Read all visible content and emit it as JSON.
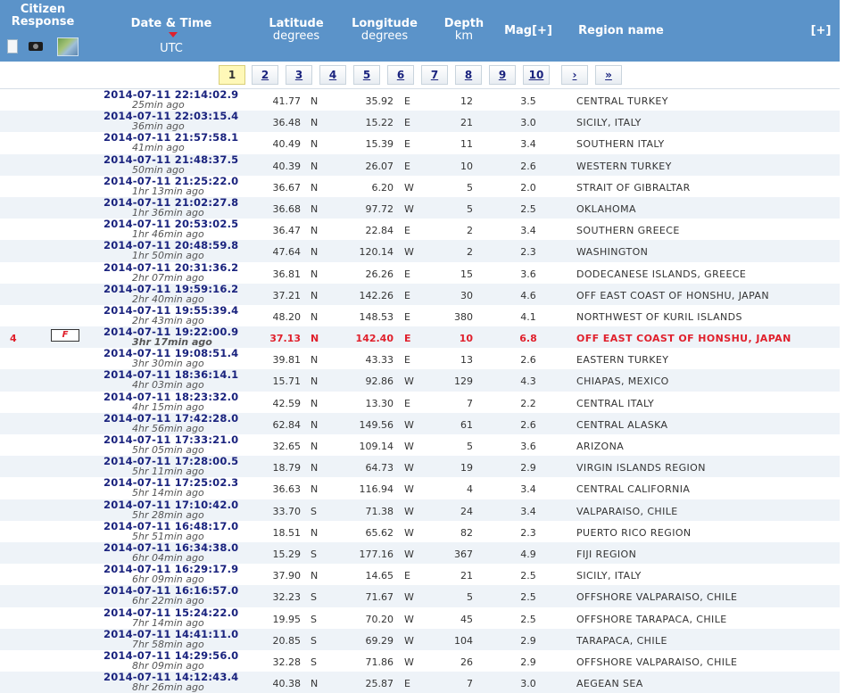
{
  "header": {
    "citizen_response": "Citizen Response",
    "date_time": "Date & Time",
    "date_time_sub": "UTC",
    "latitude": "Latitude",
    "latitude_sub": "degrees",
    "longitude": "Longitude",
    "longitude_sub": "degrees",
    "depth": "Depth",
    "depth_sub": "km",
    "mag": "Mag[+]",
    "region": "Region name",
    "expand": "[+]",
    "icons": [
      "document-icon",
      "camera-icon",
      "map-icon"
    ]
  },
  "pagination": {
    "pages": [
      "1",
      "2",
      "3",
      "4",
      "5",
      "6",
      "7",
      "8",
      "9",
      "10",
      "›",
      "»"
    ],
    "current": "1"
  },
  "colors": {
    "header_bg": "#5b93c9",
    "row_alt": "#eef3f8",
    "highlight": "#e0202c",
    "date_text": "#1a237e"
  },
  "rows": [
    {
      "datetime": "2014-07-11   22:14:02.9",
      "ago": "25min ago",
      "lat": "41.77",
      "lat_dir": "N",
      "lon": "35.92",
      "lon_dir": "E",
      "depth": "12",
      "mag": "3.5",
      "region": "CENTRAL TURKEY"
    },
    {
      "datetime": "2014-07-11   22:03:15.4",
      "ago": "36min ago",
      "lat": "36.48",
      "lat_dir": "N",
      "lon": "15.22",
      "lon_dir": "E",
      "depth": "21",
      "mag": "3.0",
      "region": "SICILY, ITALY"
    },
    {
      "datetime": "2014-07-11   21:57:58.1",
      "ago": "41min ago",
      "lat": "40.49",
      "lat_dir": "N",
      "lon": "15.39",
      "lon_dir": "E",
      "depth": "11",
      "mag": "3.4",
      "region": "SOUTHERN ITALY"
    },
    {
      "datetime": "2014-07-11   21:48:37.5",
      "ago": "50min ago",
      "lat": "40.39",
      "lat_dir": "N",
      "lon": "26.07",
      "lon_dir": "E",
      "depth": "10",
      "mag": "2.6",
      "region": "WESTERN TURKEY"
    },
    {
      "datetime": "2014-07-11   21:25:22.0",
      "ago": "1hr 13min ago",
      "lat": "36.67",
      "lat_dir": "N",
      "lon": "6.20",
      "lon_dir": "W",
      "depth": "5",
      "mag": "2.0",
      "region": "STRAIT OF GIBRALTAR"
    },
    {
      "datetime": "2014-07-11   21:02:27.8",
      "ago": "1hr 36min ago",
      "lat": "36.68",
      "lat_dir": "N",
      "lon": "97.72",
      "lon_dir": "W",
      "depth": "5",
      "mag": "2.5",
      "region": "OKLAHOMA"
    },
    {
      "datetime": "2014-07-11   20:53:02.5",
      "ago": "1hr 46min ago",
      "lat": "36.47",
      "lat_dir": "N",
      "lon": "22.84",
      "lon_dir": "E",
      "depth": "2",
      "mag": "3.4",
      "region": "SOUTHERN GREECE"
    },
    {
      "datetime": "2014-07-11   20:48:59.8",
      "ago": "1hr 50min ago",
      "lat": "47.64",
      "lat_dir": "N",
      "lon": "120.14",
      "lon_dir": "W",
      "depth": "2",
      "mag": "2.3",
      "region": "WASHINGTON"
    },
    {
      "datetime": "2014-07-11   20:31:36.2",
      "ago": "2hr 07min ago",
      "lat": "36.81",
      "lat_dir": "N",
      "lon": "26.26",
      "lon_dir": "E",
      "depth": "15",
      "mag": "3.6",
      "region": "DODECANESE ISLANDS, GREECE"
    },
    {
      "datetime": "2014-07-11   19:59:16.2",
      "ago": "2hr 40min ago",
      "lat": "37.21",
      "lat_dir": "N",
      "lon": "142.26",
      "lon_dir": "E",
      "depth": "30",
      "mag": "4.6",
      "region": "OFF EAST COAST OF HONSHU, JAPAN"
    },
    {
      "datetime": "2014-07-11   19:55:39.4",
      "ago": "2hr 43min ago",
      "lat": "48.20",
      "lat_dir": "N",
      "lon": "148.53",
      "lon_dir": "E",
      "depth": "380",
      "mag": "4.1",
      "region": "NORTHWEST OF KURIL ISLANDS"
    },
    {
      "datetime": "2014-07-11   19:22:00.9",
      "ago": "3hr 17min ago",
      "lat": "37.13",
      "lat_dir": "N",
      "lon": "142.40",
      "lon_dir": "E",
      "depth": "10",
      "mag": "6.8",
      "region": "OFF EAST COAST OF HONSHU, JAPAN",
      "highlight": true,
      "responses": "4",
      "flag": "F"
    },
    {
      "datetime": "2014-07-11   19:08:51.4",
      "ago": "3hr 30min ago",
      "lat": "39.81",
      "lat_dir": "N",
      "lon": "43.33",
      "lon_dir": "E",
      "depth": "13",
      "mag": "2.6",
      "region": "EASTERN TURKEY"
    },
    {
      "datetime": "2014-07-11   18:36:14.1",
      "ago": "4hr 03min ago",
      "lat": "15.71",
      "lat_dir": "N",
      "lon": "92.86",
      "lon_dir": "W",
      "depth": "129",
      "mag": "4.3",
      "region": "CHIAPAS, MEXICO"
    },
    {
      "datetime": "2014-07-11   18:23:32.0",
      "ago": "4hr 15min ago",
      "lat": "42.59",
      "lat_dir": "N",
      "lon": "13.30",
      "lon_dir": "E",
      "depth": "7",
      "mag": "2.2",
      "region": "CENTRAL ITALY"
    },
    {
      "datetime": "2014-07-11   17:42:28.0",
      "ago": "4hr 56min ago",
      "lat": "62.84",
      "lat_dir": "N",
      "lon": "149.56",
      "lon_dir": "W",
      "depth": "61",
      "mag": "2.6",
      "region": "CENTRAL ALASKA"
    },
    {
      "datetime": "2014-07-11   17:33:21.0",
      "ago": "5hr 05min ago",
      "lat": "32.65",
      "lat_dir": "N",
      "lon": "109.14",
      "lon_dir": "W",
      "depth": "5",
      "mag": "3.6",
      "region": "ARIZONA"
    },
    {
      "datetime": "2014-07-11   17:28:00.5",
      "ago": "5hr 11min ago",
      "lat": "18.79",
      "lat_dir": "N",
      "lon": "64.73",
      "lon_dir": "W",
      "depth": "19",
      "mag": "2.9",
      "region": "VIRGIN ISLANDS REGION"
    },
    {
      "datetime": "2014-07-11   17:25:02.3",
      "ago": "5hr 14min ago",
      "lat": "36.63",
      "lat_dir": "N",
      "lon": "116.94",
      "lon_dir": "W",
      "depth": "4",
      "mag": "3.4",
      "region": "CENTRAL CALIFORNIA"
    },
    {
      "datetime": "2014-07-11   17:10:42.0",
      "ago": "5hr 28min ago",
      "lat": "33.70",
      "lat_dir": "S",
      "lon": "71.38",
      "lon_dir": "W",
      "depth": "24",
      "mag": "3.4",
      "region": "VALPARAISO, CHILE"
    },
    {
      "datetime": "2014-07-11   16:48:17.0",
      "ago": "5hr 51min ago",
      "lat": "18.51",
      "lat_dir": "N",
      "lon": "65.62",
      "lon_dir": "W",
      "depth": "82",
      "mag": "2.3",
      "region": "PUERTO RICO REGION"
    },
    {
      "datetime": "2014-07-11   16:34:38.0",
      "ago": "6hr 04min ago",
      "lat": "15.29",
      "lat_dir": "S",
      "lon": "177.16",
      "lon_dir": "W",
      "depth": "367",
      "mag": "4.9",
      "region": "FIJI REGION"
    },
    {
      "datetime": "2014-07-11   16:29:17.9",
      "ago": "6hr 09min ago",
      "lat": "37.90",
      "lat_dir": "N",
      "lon": "14.65",
      "lon_dir": "E",
      "depth": "21",
      "mag": "2.5",
      "region": "SICILY, ITALY"
    },
    {
      "datetime": "2014-07-11   16:16:57.0",
      "ago": "6hr 22min ago",
      "lat": "32.23",
      "lat_dir": "S",
      "lon": "71.67",
      "lon_dir": "W",
      "depth": "5",
      "mag": "2.5",
      "region": "OFFSHORE VALPARAISO, CHILE"
    },
    {
      "datetime": "2014-07-11   15:24:22.0",
      "ago": "7hr 14min ago",
      "lat": "19.95",
      "lat_dir": "S",
      "lon": "70.20",
      "lon_dir": "W",
      "depth": "45",
      "mag": "2.5",
      "region": "OFFSHORE TARAPACA, CHILE"
    },
    {
      "datetime": "2014-07-11   14:41:11.0",
      "ago": "7hr 58min ago",
      "lat": "20.85",
      "lat_dir": "S",
      "lon": "69.29",
      "lon_dir": "W",
      "depth": "104",
      "mag": "2.9",
      "region": "TARAPACA, CHILE"
    },
    {
      "datetime": "2014-07-11   14:29:56.0",
      "ago": "8hr 09min ago",
      "lat": "32.28",
      "lat_dir": "S",
      "lon": "71.86",
      "lon_dir": "W",
      "depth": "26",
      "mag": "2.9",
      "region": "OFFSHORE VALPARAISO, CHILE"
    },
    {
      "datetime": "2014-07-11   14:12:43.4",
      "ago": "8hr 26min ago",
      "lat": "40.38",
      "lat_dir": "N",
      "lon": "25.87",
      "lon_dir": "E",
      "depth": "7",
      "mag": "3.0",
      "region": "AEGEAN SEA"
    }
  ]
}
